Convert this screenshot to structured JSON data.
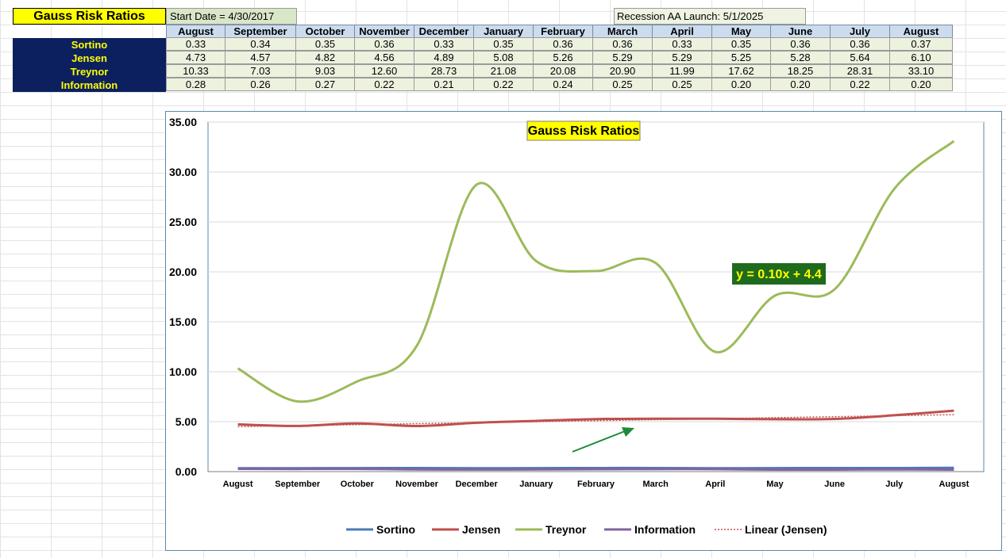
{
  "header": {
    "title": "Gauss Risk Ratios",
    "start_date": "Start Date = 4/30/2017",
    "recession": "Recession AA Launch:  5/1/2025"
  },
  "table": {
    "months": [
      "August",
      "September",
      "October",
      "November",
      "December",
      "January",
      "February",
      "March",
      "April",
      "May",
      "June",
      "July",
      "August"
    ],
    "rows": [
      {
        "label": "Sortino",
        "values": [
          "0.33",
          "0.34",
          "0.35",
          "0.36",
          "0.33",
          "0.35",
          "0.36",
          "0.36",
          "0.33",
          "0.35",
          "0.36",
          "0.36",
          "0.37"
        ]
      },
      {
        "label": "Jensen",
        "values": [
          "4.73",
          "4.57",
          "4.82",
          "4.56",
          "4.89",
          "5.08",
          "5.26",
          "5.29",
          "5.29",
          "5.25",
          "5.28",
          "5.64",
          "6.10"
        ]
      },
      {
        "label": "Treynor",
        "values": [
          "10.33",
          "7.03",
          "9.03",
          "12.60",
          "28.73",
          "21.08",
          "20.08",
          "20.90",
          "11.99",
          "17.62",
          "18.25",
          "28.31",
          "33.10"
        ]
      },
      {
        "label": "Information",
        "values": [
          "0.28",
          "0.26",
          "0.27",
          "0.22",
          "0.21",
          "0.22",
          "0.24",
          "0.25",
          "0.25",
          "0.20",
          "0.20",
          "0.22",
          "0.20"
        ]
      }
    ]
  },
  "chart_data": {
    "type": "line",
    "title": "Gauss Risk Ratios",
    "categories": [
      "August",
      "September",
      "October",
      "November",
      "December",
      "January",
      "February",
      "March",
      "April",
      "May",
      "June",
      "July",
      "August"
    ],
    "ylim": [
      0,
      35
    ],
    "yticks": [
      "0.00",
      "5.00",
      "10.00",
      "15.00",
      "20.00",
      "25.00",
      "30.00",
      "35.00"
    ],
    "grid": true,
    "legend_position": "bottom",
    "series": [
      {
        "name": "Sortino",
        "color": "#4a7ab8",
        "values": [
          0.33,
          0.34,
          0.35,
          0.36,
          0.33,
          0.35,
          0.36,
          0.36,
          0.33,
          0.35,
          0.36,
          0.36,
          0.37
        ]
      },
      {
        "name": "Jensen",
        "color": "#c0504d",
        "values": [
          4.73,
          4.57,
          4.82,
          4.56,
          4.89,
          5.08,
          5.26,
          5.29,
          5.29,
          5.25,
          5.28,
          5.64,
          6.1
        ]
      },
      {
        "name": "Treynor",
        "color": "#9bbb59",
        "values": [
          10.33,
          7.03,
          9.03,
          12.6,
          28.73,
          21.08,
          20.08,
          20.9,
          11.99,
          17.62,
          18.25,
          28.31,
          33.1
        ]
      },
      {
        "name": "Information",
        "color": "#8064a2",
        "values": [
          0.28,
          0.26,
          0.27,
          0.22,
          0.21,
          0.22,
          0.24,
          0.25,
          0.25,
          0.2,
          0.2,
          0.22,
          0.2
        ]
      }
    ],
    "trendline": {
      "name": "Linear (Jensen)",
      "color": "#c0504d",
      "slope": 0.1,
      "intercept": 4.4,
      "label": "y = 0.10x + 4.4"
    }
  }
}
